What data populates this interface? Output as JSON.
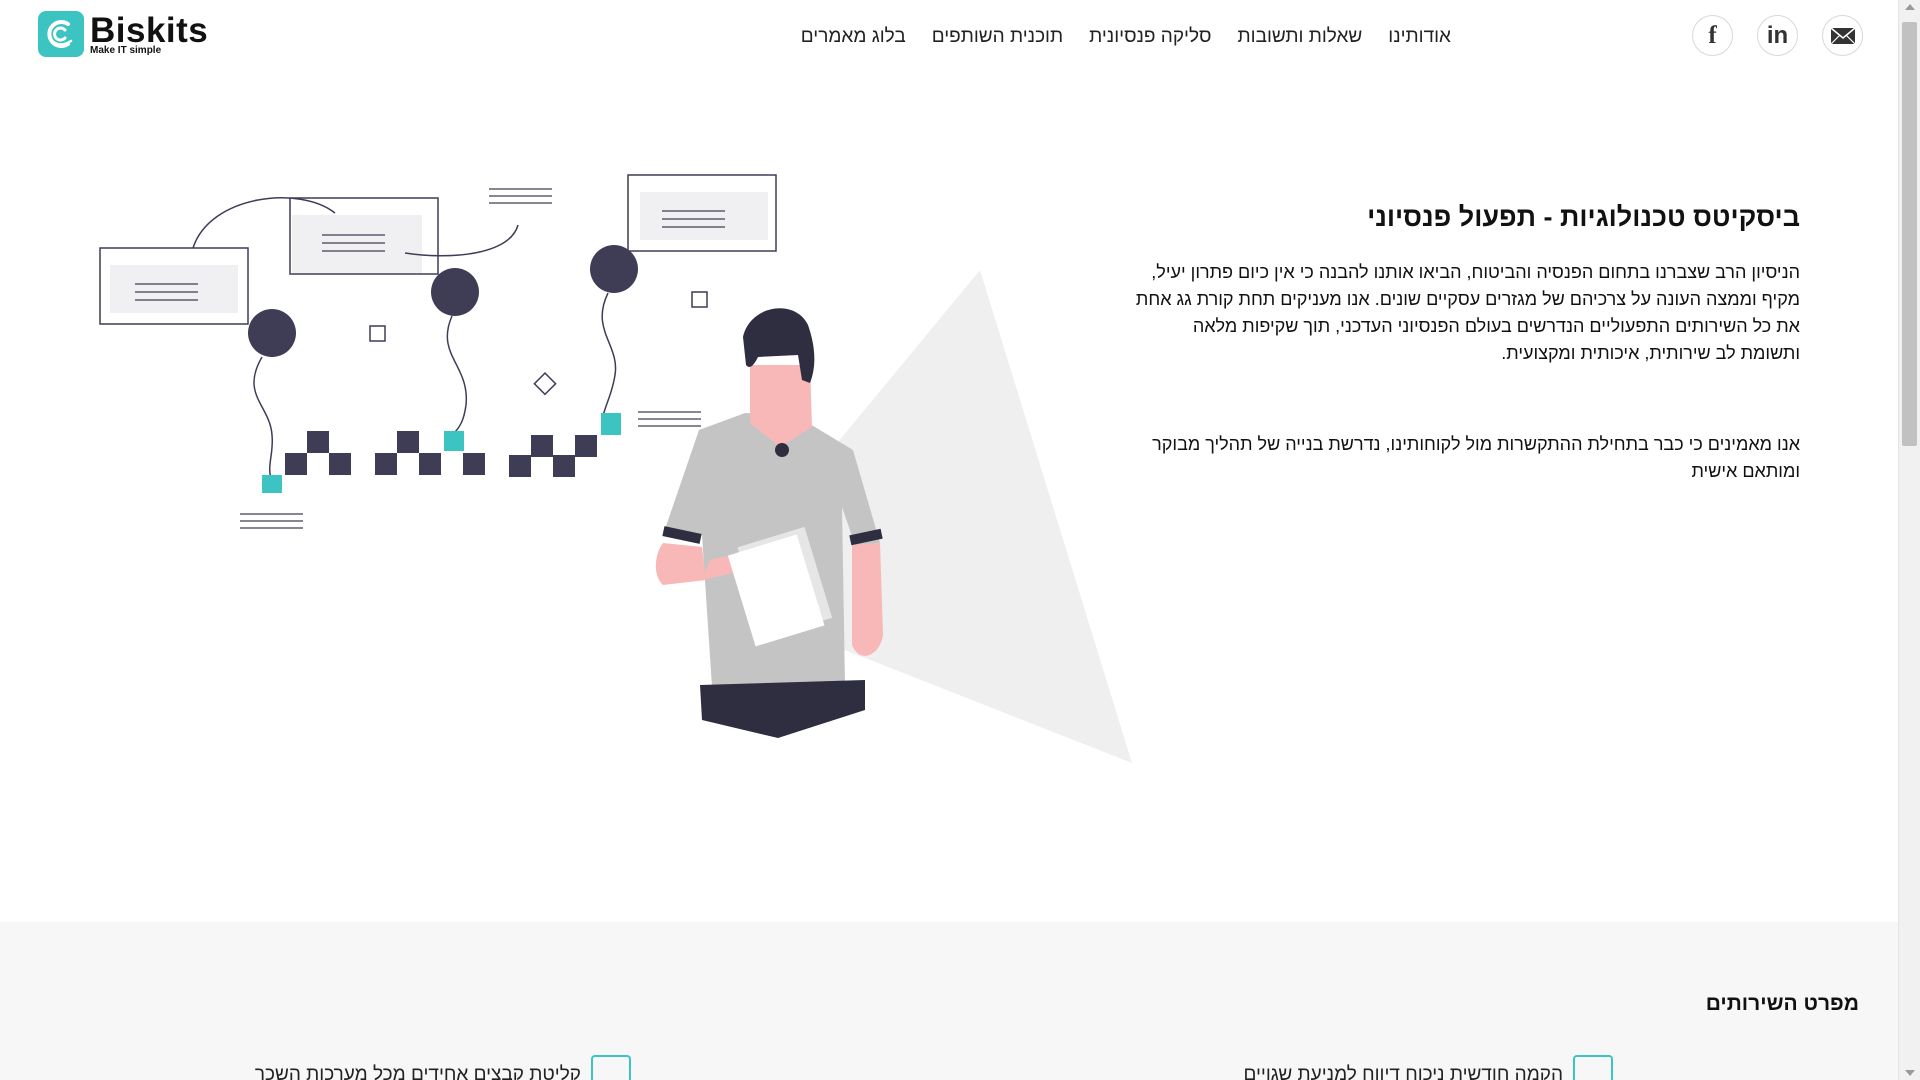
{
  "brand": {
    "name": "Biskits",
    "tagline": "Make IT simple",
    "accent_color": "#3cc4c2"
  },
  "nav": {
    "items": [
      {
        "label": "אודותינו"
      },
      {
        "label": "שאלות ותשובות"
      },
      {
        "label": "סליקה פנסיונית"
      },
      {
        "label": "תוכנית השותפים"
      },
      {
        "label": "בלוג מאמרים"
      }
    ]
  },
  "social": {
    "icons": [
      "mail-icon",
      "linkedin-icon",
      "facebook-icon"
    ],
    "linkedin_text": "in",
    "facebook_text": "f"
  },
  "hero": {
    "title": "ביסקיטס טכנולוגיות - תפעול פנסיוני",
    "paragraph1": "הניסיון הרב שצברנו בתחום הפנסיה והביטוח, הביאו אותנו להבנה כי אין כיום פתרון יעיל, מקיף וממצה העונה על צרכיהם של מגזרים עסקיים שונים. אנו מעניקים תחת קורת גג אחת את כל השירותים התפעוליים הנדרשים בעולם הפנסיוני העדכני, תוך שקיפות מלאה ותשומת לב שירותית, איכותית ומקצועית.",
    "paragraph2": "אנו מאמינים כי כבר בתחילת ההתקשרות מול לקוחותינו, נדרשת בנייה של תהליך מבוקר ומותאם אישית"
  },
  "services": {
    "title": "מפרט השירותים",
    "items": [
      {
        "label": "הקמה חודשית ניכוח דיווח למניעת שגויים",
        "icon": "download-doc-icon"
      },
      {
        "label": "קליטת קבצים אחידים מכל מערכות השכר",
        "icon": "gear-window-icon"
      }
    ]
  }
}
